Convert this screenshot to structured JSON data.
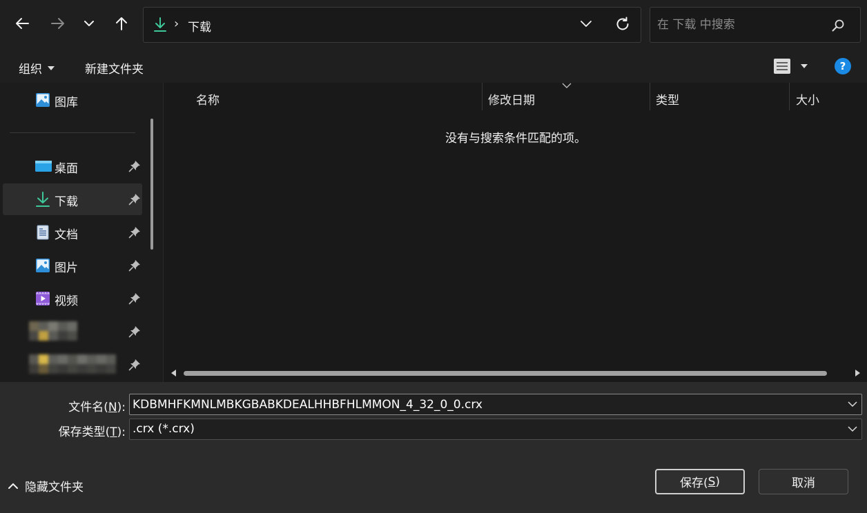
{
  "address_bar": {
    "breadcrumb": "下载",
    "separator": "›",
    "search_placeholder": "在 下载 中搜索"
  },
  "command_bar": {
    "organize": "组织",
    "new_folder": "新建文件夹"
  },
  "nav_pane": {
    "items": [
      {
        "label": "图库",
        "icon": "gallery-icon"
      },
      {
        "label": "桌面",
        "icon": "desktop-icon",
        "pinned": true
      },
      {
        "label": "下载",
        "icon": "download-icon",
        "pinned": true,
        "selected": true
      },
      {
        "label": "文档",
        "icon": "documents-icon",
        "pinned": true
      },
      {
        "label": "图片",
        "icon": "pictures-icon",
        "pinned": true
      },
      {
        "label": "视频",
        "icon": "videos-icon",
        "pinned": true
      }
    ]
  },
  "file_list": {
    "columns": [
      "名称",
      "修改日期",
      "类型",
      "大小"
    ],
    "empty_message": "没有与搜索条件匹配的项。"
  },
  "save_area": {
    "filename_label": "文件名(",
    "filename_key": "N",
    "filename_label_end": "):",
    "filename_value": "KDBMHFKMNLMBKGBABKDEALHHBFHLMMON_4_32_0_0.crx",
    "filetype_label": "保存类型(",
    "filetype_key": "T",
    "filetype_label_end": "):",
    "filetype_value": ".crx (*.crx)",
    "hide_folders": "隐藏文件夹",
    "save_button": "保存(",
    "save_key": "S",
    "save_button_end": ")",
    "cancel_button": "取消"
  },
  "colors": {
    "accent": "#1a8ae5",
    "download_green": "#3fc99a",
    "background": "#1c1c1c",
    "bottom_panel": "#2b2b2b"
  }
}
